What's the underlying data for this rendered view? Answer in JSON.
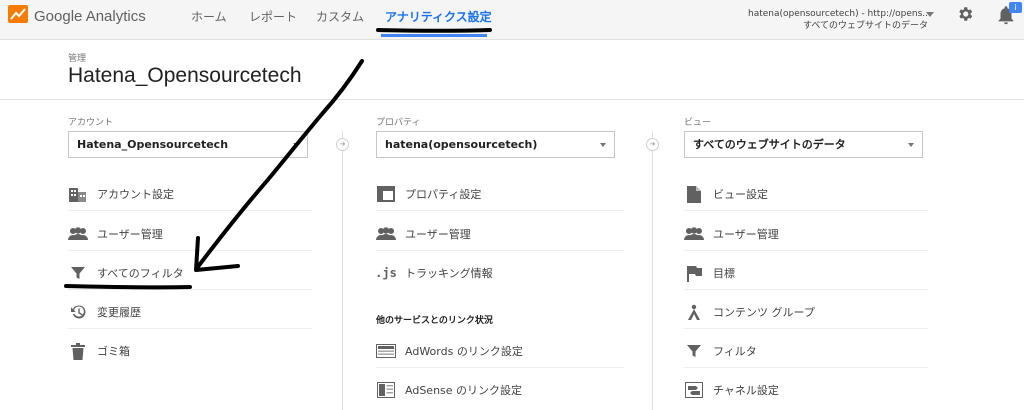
{
  "app": {
    "brand": "Google Analytics"
  },
  "nav": {
    "tabs": [
      {
        "label": "ホーム"
      },
      {
        "label": "レポート"
      },
      {
        "label": "カスタム"
      },
      {
        "label": "アナリティクス設定",
        "active": true
      }
    ]
  },
  "account_switcher": {
    "line1": "hatena(opensourcetech) - http://opens...",
    "line2": "すべてのウェブサイトのデータ"
  },
  "notifications": {
    "badge": "i"
  },
  "header": {
    "admin_label": "管理",
    "title": "Hatena_Opensourcetech"
  },
  "columns": {
    "account": {
      "label": "アカウント",
      "selected": "Hatena_Opensourcetech",
      "items": [
        {
          "label": "アカウント設定",
          "icon": "building-icon"
        },
        {
          "label": "ユーザー管理",
          "icon": "users-icon"
        },
        {
          "label": "すべてのフィルタ",
          "icon": "filter-icon"
        },
        {
          "label": "変更履歴",
          "icon": "history-icon"
        },
        {
          "label": "ゴミ箱",
          "icon": "trash-icon"
        }
      ]
    },
    "property": {
      "label": "プロパティ",
      "selected": "hatena(opensourcetech)",
      "items": [
        {
          "label": "プロパティ設定",
          "icon": "window-icon"
        },
        {
          "label": "ユーザー管理",
          "icon": "users-icon"
        },
        {
          "label": "トラッキング情報",
          "icon": "js-icon",
          "icon_text": ".js"
        }
      ],
      "section_label": "他のサービスとのリンク状況",
      "link_items": [
        {
          "label": "AdWords のリンク設定",
          "icon": "adwords-icon"
        },
        {
          "label": "AdSense のリンク設定",
          "icon": "adsense-icon"
        }
      ]
    },
    "view": {
      "label": "ビュー",
      "selected": "すべてのウェブサイトのデータ",
      "items": [
        {
          "label": "ビュー設定",
          "icon": "document-icon"
        },
        {
          "label": "ユーザー管理",
          "icon": "users-icon"
        },
        {
          "label": "目標",
          "icon": "flag-icon"
        },
        {
          "label": "コンテンツ グループ",
          "icon": "content-group-icon"
        },
        {
          "label": "フィルタ",
          "icon": "filter-icon"
        },
        {
          "label": "チャネル設定",
          "icon": "channel-icon"
        }
      ]
    }
  },
  "colors": {
    "accent": "#4285f4",
    "active_tab": "#1a73e8",
    "icon": "#616161",
    "annotation": "#000000"
  }
}
